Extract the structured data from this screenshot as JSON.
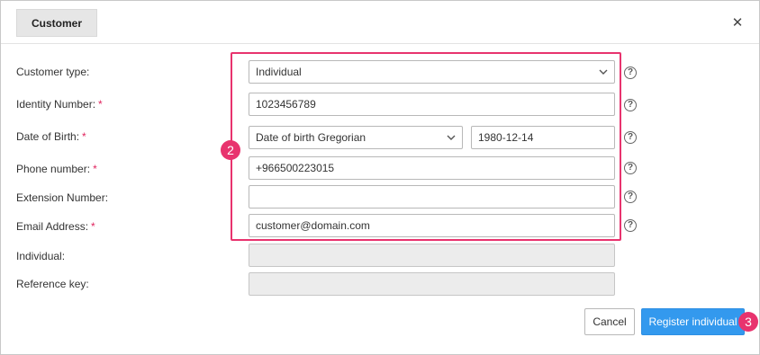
{
  "dialog": {
    "tab_label": "Customer",
    "close_glyph": "✕"
  },
  "form": {
    "fields": [
      {
        "label": "Customer type:",
        "required": false,
        "kind": "select",
        "value": "Individual"
      },
      {
        "label": "Identity Number:",
        "required": true,
        "kind": "input",
        "value": "1023456789"
      },
      {
        "label": "Date of Birth:",
        "required": true,
        "kind": "select+input",
        "calendar": "Date of birth Gregorian",
        "value": "1980-12-14"
      },
      {
        "label": "Phone number:",
        "required": true,
        "kind": "input",
        "value": "+966500223015"
      },
      {
        "label": "Extension Number:",
        "required": false,
        "kind": "input",
        "value": ""
      },
      {
        "label": "Email Address:",
        "required": true,
        "kind": "input",
        "value": "customer@domain.com"
      },
      {
        "label": "Individual:",
        "required": false,
        "kind": "readonly",
        "value": ""
      },
      {
        "label": "Reference key:",
        "required": false,
        "kind": "readonly",
        "value": ""
      }
    ],
    "required_mark": "*",
    "help_glyph": "?"
  },
  "annotations": {
    "highlight_color": "#e8336e",
    "marker_fields": "2",
    "marker_submit": "3"
  },
  "buttons": {
    "cancel_label": "Cancel",
    "submit_label": "Register individual"
  },
  "colors": {
    "primary": "#3399ee",
    "accent": "#e8336e",
    "disabled_bg": "#ececec"
  }
}
